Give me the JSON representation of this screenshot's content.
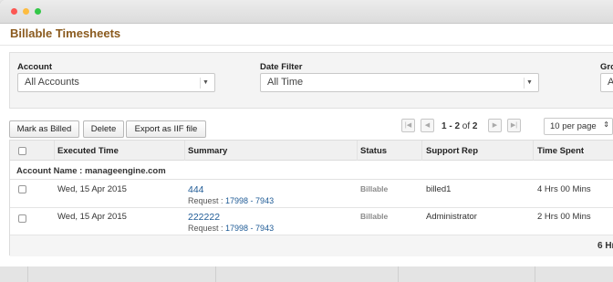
{
  "window": {
    "dots": [
      "#fc5753",
      "#fdbc40",
      "#33c748"
    ]
  },
  "page": {
    "title": "Billable Timesheets"
  },
  "filters": {
    "account": {
      "label": "Account",
      "value": "All Accounts"
    },
    "date": {
      "label": "Date Filter",
      "value": "All Time"
    },
    "group": {
      "label": "Gro",
      "value": "A"
    }
  },
  "toolbar": {
    "mark_billed": "Mark as Billed",
    "delete": "Delete",
    "export": "Export as IIF file"
  },
  "pager": {
    "range": "1 - 2",
    "of": "of",
    "total": "2",
    "per_page": "10 per page"
  },
  "table": {
    "headers": {
      "executed": "Executed Time",
      "summary": "Summary",
      "status": "Status",
      "support_rep": "Support Rep",
      "time_spent": "Time Spent"
    },
    "group_label": "Account Name : manageengine.com",
    "rows": [
      {
        "executed": "Wed, 15 Apr 2015",
        "summary": "444",
        "request_prefix": "Request : ",
        "request_link": "17998 - 7943",
        "status": "Billable",
        "rep": "billed1",
        "time": "4 Hrs 00 Mins"
      },
      {
        "executed": "Wed, 15 Apr 2015",
        "summary": "222222",
        "request_prefix": "Request : ",
        "request_link": "17998 - 7943",
        "status": "Billable",
        "rep": "Administrator",
        "time": "2 Hrs 00 Mins"
      }
    ],
    "total": "6 Hr"
  }
}
